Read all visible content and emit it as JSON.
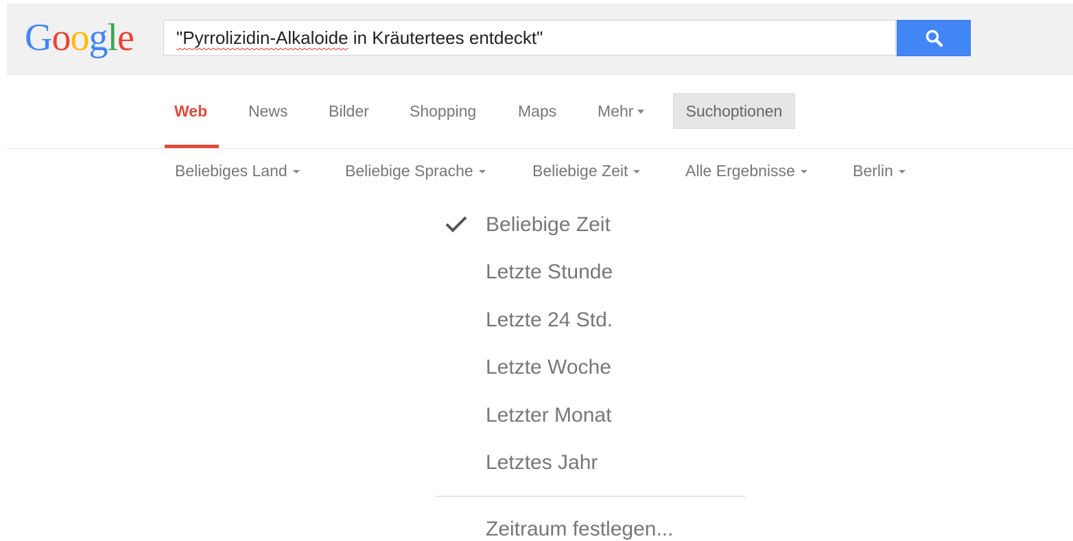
{
  "logo": {
    "text": "Google"
  },
  "search": {
    "query_misspelled": "\"Pyrrolizidin-Alkaloide",
    "query_rest": " in Kräutertees entdeckt\""
  },
  "nav": {
    "tabs": [
      {
        "label": "Web",
        "active": true
      },
      {
        "label": "News"
      },
      {
        "label": "Bilder"
      },
      {
        "label": "Shopping"
      },
      {
        "label": "Maps"
      },
      {
        "label": "Mehr"
      }
    ],
    "tools_label": "Suchoptionen"
  },
  "filters": [
    {
      "label": "Beliebiges Land"
    },
    {
      "label": "Beliebige Sprache"
    },
    {
      "label": "Beliebige Zeit"
    },
    {
      "label": "Alle Ergebnisse"
    },
    {
      "label": "Berlin"
    }
  ],
  "time_menu": {
    "items": [
      {
        "label": "Beliebige Zeit",
        "checked": true
      },
      {
        "label": "Letzte Stunde"
      },
      {
        "label": "Letzte 24 Std."
      },
      {
        "label": "Letzte Woche"
      },
      {
        "label": "Letzter Monat"
      },
      {
        "label": "Letztes Jahr"
      }
    ],
    "custom_range": "Zeitraum festlegen..."
  },
  "colors": {
    "search_button": "#4285f4",
    "active_tab": "#dd4b39",
    "logo": [
      "#4285f4",
      "#ea4335",
      "#fbbc05",
      "#4285f4",
      "#34a853",
      "#ea4335"
    ]
  },
  "icons": {
    "search": "magnifier-icon",
    "check": "check-icon",
    "dropdown": "caret-down-icon"
  }
}
